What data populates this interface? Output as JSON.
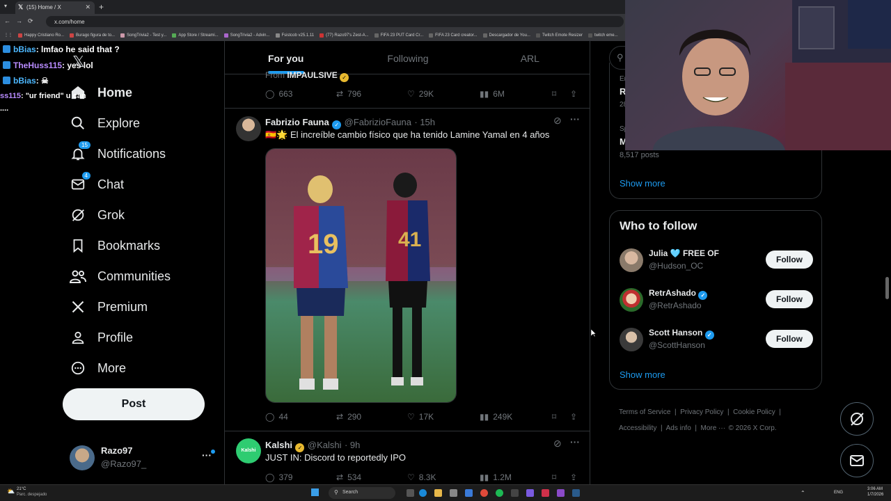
{
  "browser": {
    "tab_title": "(15) Home / X",
    "new_tab": "+",
    "url": "x.com/home",
    "bookmarks": [
      "Happy Cristiano Ro...",
      "Burago figura de to...",
      "SongTrivia2 - Test y...",
      "App Store / Streami...",
      "SongTrivia2 - Advin...",
      "Fsistcob v25.1.11",
      "(77) Razo97's Zest-A...",
      "FIFA 23 PUT Card Cr...",
      "FIFA 23 Card creator...",
      "Descargador de You...",
      "Twitch Emote Resizer",
      "twitch eme..."
    ]
  },
  "chat": [
    {
      "user": "bBias",
      "message": ": lmfao he said that ?",
      "color": "#4db8ff"
    },
    {
      "user": "TheHuss115",
      "message": ": yes lol",
      "color": "#b98cff"
    },
    {
      "user": "bBias",
      "message": ":",
      "color": "#4db8ff"
    },
    {
      "user": "ss115",
      "message": ": \"ur friend\" u can",
      "color": "#b98cff"
    },
    {
      "user": "",
      "message": "....",
      "color": "#fff"
    }
  ],
  "nav": {
    "home": "Home",
    "explore": "Explore",
    "notifications": "Notifications",
    "notifications_count": "15",
    "chat": "Chat",
    "chat_count": "4",
    "grok": "Grok",
    "bookmarks": "Bookmarks",
    "communities": "Communities",
    "premium": "Premium",
    "profile": "Profile",
    "more": "More",
    "post": "Post"
  },
  "account": {
    "name": "Razo97",
    "handle": "@Razo97_"
  },
  "feed_tabs": [
    "For you",
    "Following",
    "ARL"
  ],
  "partial_tweet": {
    "from_prefix": "From",
    "from_name": "IMPAULSIVE",
    "replies": "663",
    "reposts": "796",
    "likes": "29K",
    "views": "6M"
  },
  "tweet1": {
    "name": "Fabrizio Fauna",
    "handle": "@FabrizioFauna",
    "time": "· 15h",
    "text": "🇪🇸🌟 El increíble cambio físico que ha tenido Lamine Yamal en 4 años",
    "replies": "44",
    "reposts": "290",
    "likes": "17K",
    "views": "249K",
    "image_jersey_left": "19",
    "image_jersey_right": "41"
  },
  "tweet2": {
    "name": "Kalshi",
    "handle": "@Kalshi",
    "time": "· 9h",
    "avatar_text": "Kalshi",
    "text": "JUST IN: Discord to reportedly IPO",
    "replies": "379",
    "reposts": "534",
    "likes": "8.3K",
    "views": "1.2M"
  },
  "trends": {
    "item1_top": "Er",
    "item1_title": "R",
    "item1_count": "28",
    "item2_top": "Sp",
    "item2_title": "M",
    "item2_posts": "8,517 posts",
    "show_more": "Show more"
  },
  "who_to_follow": {
    "title": "Who to follow",
    "users": [
      {
        "name": "Julia 🩵 FREE OF",
        "handle": "@Hudson_OC",
        "follow": "Follow"
      },
      {
        "name": "RetrAshado",
        "handle": "@RetrAshado",
        "follow": "Follow"
      },
      {
        "name": "Scott Hanson",
        "handle": "@ScottHanson",
        "follow": "Follow"
      }
    ],
    "show_more": "Show more"
  },
  "footer": {
    "terms": "Terms of Service",
    "privacy": "Privacy Policy",
    "cookie": "Cookie Policy",
    "accessibility": "Accessibility",
    "ads": "Ads info",
    "more": "More ···",
    "copyright": "© 2026 X Corp."
  },
  "taskbar": {
    "weather_temp": "21°C",
    "weather_desc": "Parc. despejado",
    "search": "Search",
    "lang": "ENG",
    "time": "3:06 AM",
    "date": "1/7/2026"
  },
  "colors": {
    "accent": "#1d9bf0",
    "bg": "#000000",
    "border": "#2f3336",
    "muted": "#71767b"
  }
}
